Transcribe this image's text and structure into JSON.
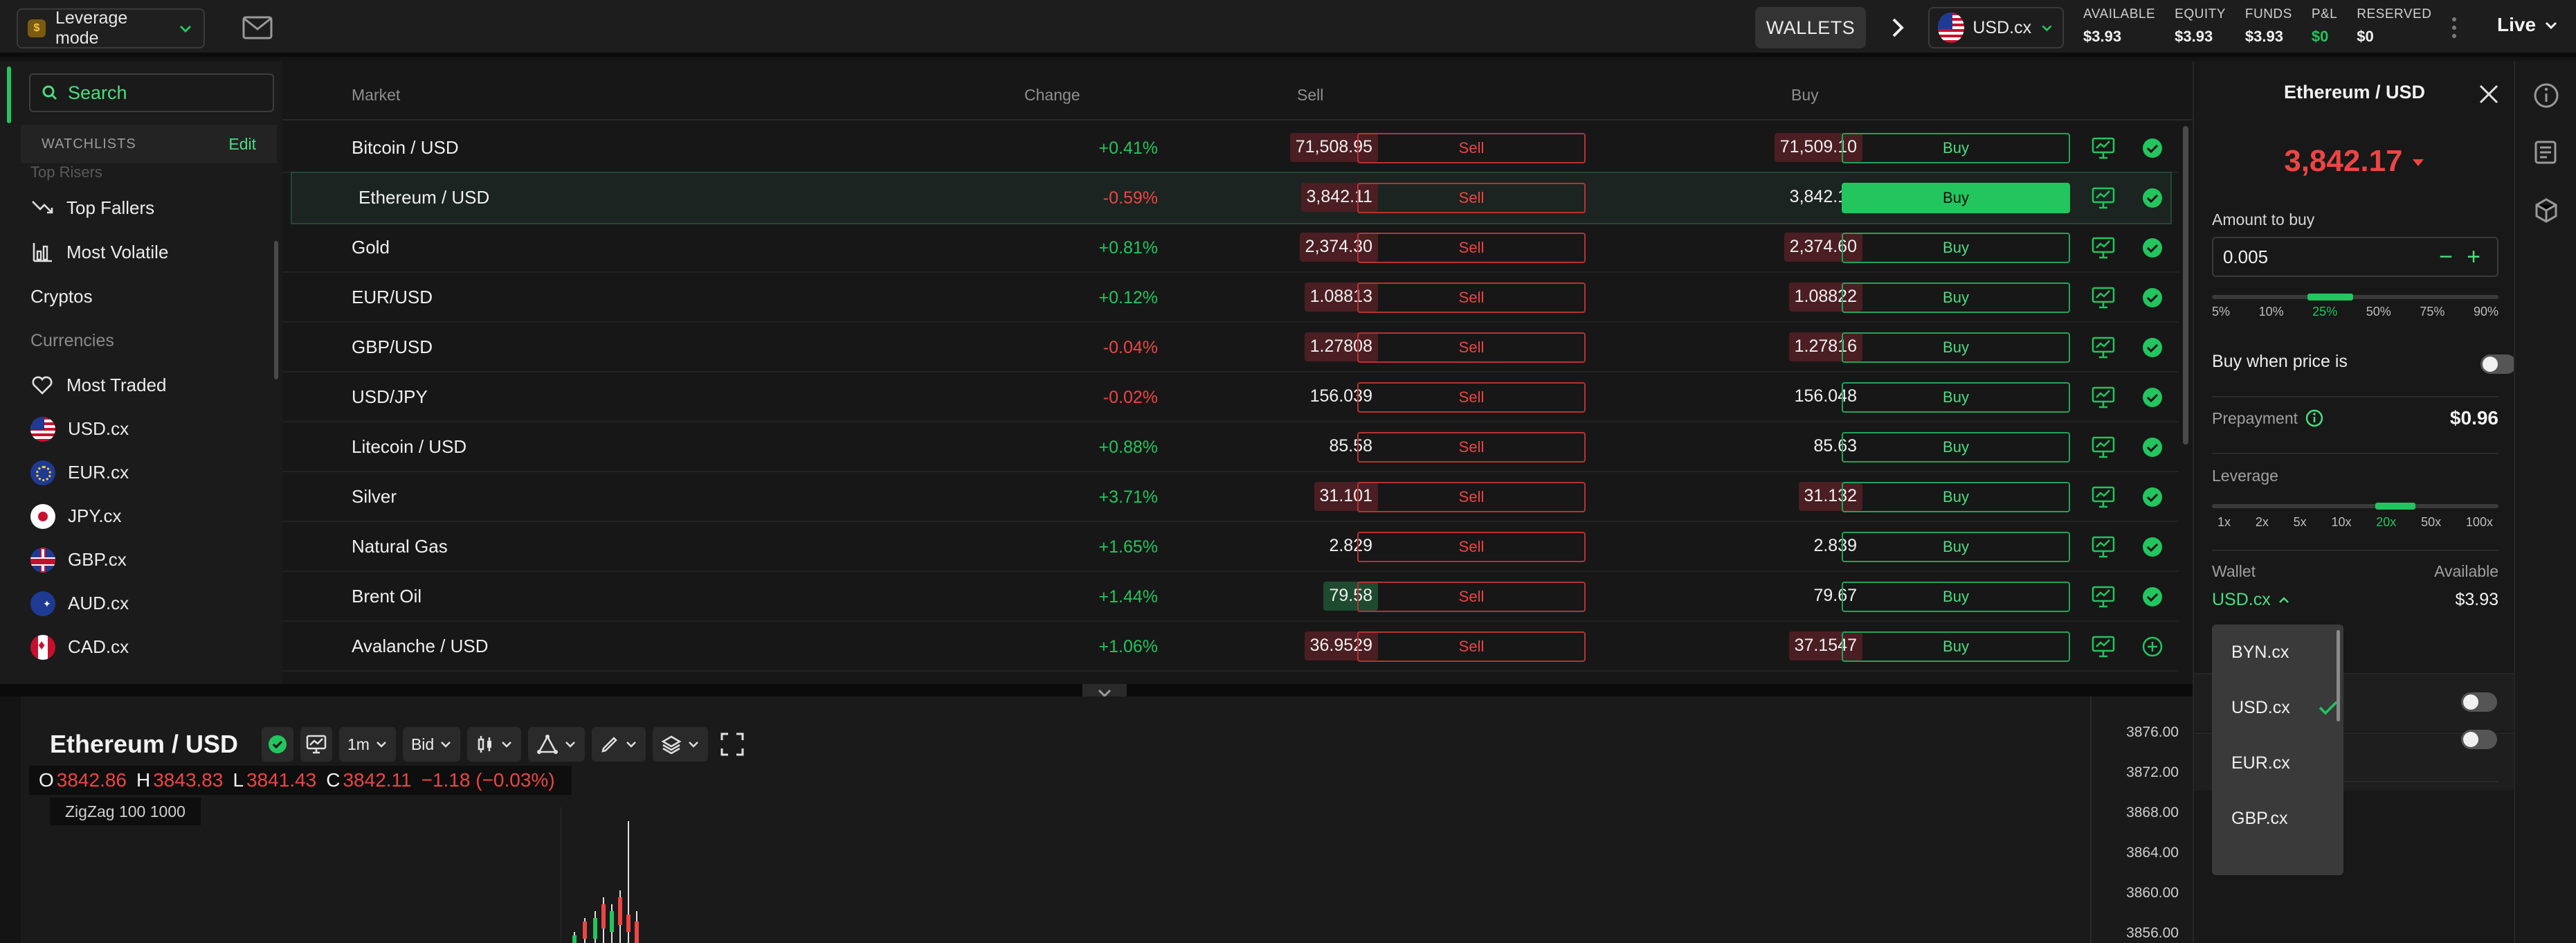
{
  "topbar": {
    "mode_label": "Leverage mode",
    "wallets_label": "WALLETS",
    "currency": "USD.cx",
    "stats": [
      {
        "label": "AVAILABLE",
        "value": "$3.93",
        "color": "#f2f2f2"
      },
      {
        "label": "EQUITY",
        "value": "$3.93",
        "color": "#f2f2f2"
      },
      {
        "label": "FUNDS",
        "value": "$3.93",
        "color": "#f2f2f2"
      },
      {
        "label": "P&L",
        "value": "$0",
        "color": "#22c55e"
      },
      {
        "label": "RESERVED",
        "value": "$0",
        "color": "#f2f2f2"
      }
    ],
    "live_label": "Live"
  },
  "sidebar": {
    "search_placeholder": "Search",
    "watchlists_title": "WATCHLISTS",
    "edit_label": "Edit",
    "cut_item": "Top Risers",
    "items": [
      {
        "label": "Top Fallers",
        "icon": "trending-down-icon"
      },
      {
        "label": "Most Volatile",
        "icon": "bar-chart-icon"
      },
      {
        "label": "Cryptos",
        "icon": ""
      }
    ],
    "currencies_heading": "Currencies",
    "currency_items": [
      {
        "label": "Most Traded",
        "icon": "heart-icon"
      },
      {
        "label": "USD.cx",
        "flag": "us"
      },
      {
        "label": "EUR.cx",
        "flag": "eu"
      },
      {
        "label": "JPY.cx",
        "flag": "jp"
      },
      {
        "label": "GBP.cx",
        "flag": "gb"
      },
      {
        "label": "AUD.cx",
        "flag": "au"
      },
      {
        "label": "CAD.cx",
        "flag": "ca"
      }
    ]
  },
  "market": {
    "headers": {
      "market": "Market",
      "change": "Change",
      "sell": "Sell",
      "buy": "Buy"
    },
    "sell_label": "Sell",
    "buy_label": "Buy",
    "rows": [
      {
        "name": "Bitcoin / USD",
        "change": "+0.41%",
        "dir": "up",
        "sell": "71,508.95",
        "sell_hl": "r",
        "buy": "71,509.10",
        "buy_hl": "r",
        "status": "check"
      },
      {
        "name": "Ethereum / USD",
        "change": "-0.59%",
        "dir": "dn",
        "sell": "3,842.11",
        "sell_hl": "r",
        "buy": "3,842.17",
        "buy_hl": "",
        "status": "check",
        "selected": true
      },
      {
        "name": "Gold",
        "change": "+0.81%",
        "dir": "up",
        "sell": "2,374.30",
        "sell_hl": "r",
        "buy": "2,374.60",
        "buy_hl": "r",
        "status": "check"
      },
      {
        "name": "EUR/USD",
        "change": "+0.12%",
        "dir": "up",
        "sell": "1.08813",
        "sell_hl": "r",
        "buy": "1.08822",
        "buy_hl": "r",
        "status": "check"
      },
      {
        "name": "GBP/USD",
        "change": "-0.04%",
        "dir": "dn",
        "sell": "1.27808",
        "sell_hl": "r",
        "buy": "1.27816",
        "buy_hl": "r",
        "status": "check"
      },
      {
        "name": "USD/JPY",
        "change": "-0.02%",
        "dir": "dn",
        "sell": "156.039",
        "sell_hl": "",
        "buy": "156.048",
        "buy_hl": "",
        "status": "check"
      },
      {
        "name": "Litecoin / USD",
        "change": "+0.88%",
        "dir": "up",
        "sell": "85.58",
        "sell_hl": "",
        "buy": "85.63",
        "buy_hl": "",
        "status": "check"
      },
      {
        "name": "Silver",
        "change": "+3.71%",
        "dir": "up",
        "sell": "31.101",
        "sell_hl": "r",
        "buy": "31.132",
        "buy_hl": "r",
        "status": "check"
      },
      {
        "name": "Natural Gas",
        "change": "+1.65%",
        "dir": "up",
        "sell": "2.829",
        "sell_hl": "",
        "buy": "2.839",
        "buy_hl": "",
        "status": "check"
      },
      {
        "name": "Brent Oil",
        "change": "+1.44%",
        "dir": "up",
        "sell": "79.58",
        "sell_hl": "g",
        "buy": "79.67",
        "buy_hl": "",
        "status": "check"
      },
      {
        "name": "Avalanche / USD",
        "change": "+1.06%",
        "dir": "up",
        "sell": "36.9529",
        "sell_hl": "r",
        "buy": "37.1547",
        "buy_hl": "r",
        "status": "plus"
      }
    ]
  },
  "chart": {
    "title": "Ethereum / USD",
    "interval": "1m",
    "price_type": "Bid",
    "ohlc": {
      "o": "3842.86",
      "h": "3843.83",
      "l": "3841.43",
      "c": "3842.11",
      "change": "−1.18 (−0.03%)"
    },
    "indicator": "ZigZag 100 1000",
    "price_ticks": [
      "3876.00",
      "3872.00",
      "3868.00",
      "3864.00",
      "3860.00",
      "3856.00"
    ]
  },
  "order": {
    "title": "Ethereum / USD",
    "price": "3,842.17",
    "amount_label": "Amount to buy",
    "amount_value": "0.005",
    "amount_pcts": [
      "5%",
      "10%",
      "25%",
      "50%",
      "75%",
      "90%"
    ],
    "amount_selected": "25%",
    "buy_when_label": "Buy when price is",
    "prepayment_label": "Prepayment",
    "prepayment_value": "$0.96",
    "leverage_label": "Leverage",
    "leverage_opts": [
      "1x",
      "2x",
      "5x",
      "10x",
      "20x",
      "50x",
      "100x"
    ],
    "leverage_selected": "20x",
    "wallet_label": "Wallet",
    "available_label": "Available",
    "wallet_value": "USD.cx",
    "available_value": "$3.93",
    "dropdown": [
      {
        "label": "BYN.cx",
        "checked": false
      },
      {
        "label": "USD.cx",
        "checked": true
      },
      {
        "label": "EUR.cx",
        "checked": false
      },
      {
        "label": "GBP.cx",
        "checked": false
      }
    ]
  },
  "colors": {
    "green": "#22c55e",
    "red": "#ef4444",
    "bg": "#141414"
  }
}
